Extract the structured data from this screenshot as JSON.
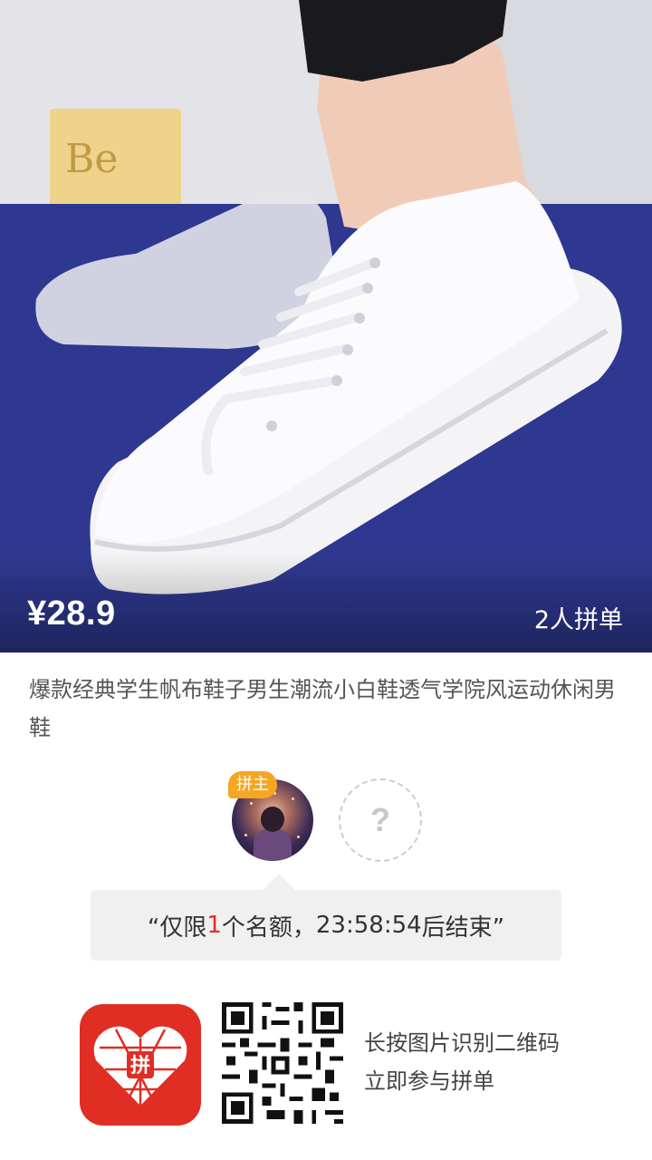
{
  "product": {
    "price": "¥28.9",
    "group_size_label": "2人拼单",
    "title": "爆款经典学生帆布鞋子男生潮流小白鞋透气学院风运动休闲男鞋",
    "image_icon": "white-canvas-sneaker-photo"
  },
  "participants": {
    "host_badge": "拼主",
    "empty_slot_symbol": "?"
  },
  "notice": {
    "prefix": "“仅限",
    "count": "1",
    "middle": "个名额，",
    "countdown": "23:58:54",
    "suffix": "后结束”"
  },
  "footer": {
    "logo_icon": "pinduoduo-logo",
    "qr_icon": "qr-code",
    "hint_line1": "长按图片识别二维码",
    "hint_line2": "立即参与拼单"
  },
  "colors": {
    "accent": "#e02e24",
    "badge": "#f5a623",
    "notice_bg": "#f0f0f0"
  }
}
